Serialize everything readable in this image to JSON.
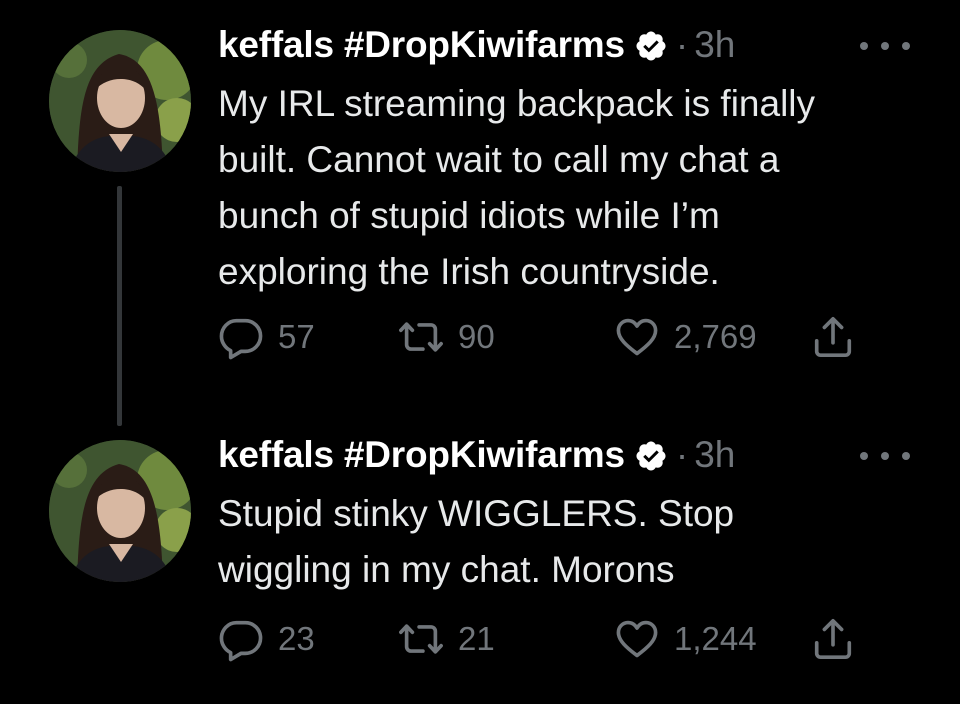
{
  "colors": {
    "background": "#000000",
    "text": "#e7e9ea",
    "muted": "#71767b",
    "verified_badge": "#ffffff",
    "thread_line": "#333639"
  },
  "tweets": [
    {
      "display_name": "keffals #DropKiwifarms",
      "separator": "·",
      "time": "3h",
      "text": "My IRL streaming backpack is finally\nbuilt. Cannot wait to call my chat a\nbunch of stupid idiots while I’m\nexploring the Irish countryside.",
      "replies": "57",
      "retweets": "90",
      "likes": "2,769",
      "icons": [
        "reply-icon",
        "retweet-icon",
        "like-icon",
        "share-icon",
        "more-icon",
        "verified-icon"
      ]
    },
    {
      "display_name": "keffals #DropKiwifarms",
      "separator": "·",
      "time": "3h",
      "text": "Stupid stinky WIGGLERS. Stop\nwiggling in my chat. Morons",
      "replies": "23",
      "retweets": "21",
      "likes": "1,244",
      "icons": [
        "reply-icon",
        "retweet-icon",
        "like-icon",
        "share-icon",
        "more-icon",
        "verified-icon"
      ]
    }
  ]
}
